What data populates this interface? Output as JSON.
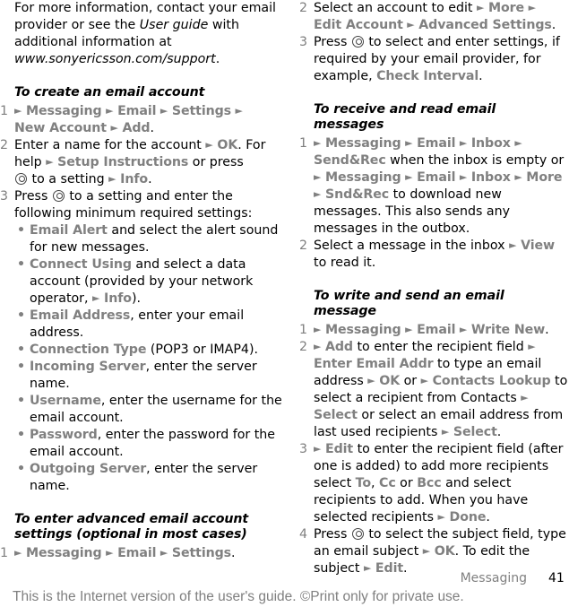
{
  "intro": {
    "t1": "For more information, contact your email provider or see the ",
    "guide": "User guide",
    "t2": " with additional information at ",
    "url": "www.sonyericsson.com/support",
    "t3": "."
  },
  "create": {
    "heading": "To create an email account",
    "s1": {
      "num": "1",
      "a": "Messaging",
      "b": "Email",
      "c": "Settings",
      "d": "New Account",
      "e": "Add",
      "end": "."
    },
    "s2": {
      "num": "2",
      "t1": "Enter a name for the account ",
      "ok": "OK",
      "t2": ". For help ",
      "setup": "Setup Instructions",
      "t3": " or press ",
      "t4": " to a setting ",
      "info": "Info",
      "end": "."
    },
    "s3": {
      "num": "3",
      "t1": "Press ",
      "t2": " to a setting and enter the following minimum required settings:"
    },
    "bullets": [
      {
        "label": "Email Alert",
        "text": " and select the alert sound for new messages."
      },
      {
        "label": "Connect Using",
        "text": " and select a data account (provided by your network operator, ",
        "info": "Info",
        "end": ")."
      },
      {
        "label": "Email Address",
        "text": ", enter your email address."
      },
      {
        "label": "Connection Type",
        "text": " (POP3 or IMAP4)."
      },
      {
        "label": "Incoming Server",
        "text": ", enter the server name."
      },
      {
        "label": "Username",
        "text": ", enter the username for the email account."
      },
      {
        "label": "Password",
        "text": ", enter the password for the email account."
      },
      {
        "label": "Outgoing Server",
        "text": ", enter the server name."
      }
    ]
  },
  "advanced": {
    "heading": "To enter advanced email account settings (optional in most cases)",
    "s1": {
      "num": "1",
      "a": "Messaging",
      "b": "Email",
      "c": "Settings",
      "end": "."
    },
    "s2": {
      "num": "2",
      "t1": "Select an account to edit ",
      "more": "More",
      "edit": "Edit Account",
      "adv": "Advanced Settings",
      "end": "."
    },
    "s3": {
      "num": "3",
      "t1": "Press ",
      "t2": " to select and enter settings, if required by your email provider, for example, ",
      "check": "Check Interval",
      "end": "."
    }
  },
  "receive": {
    "heading": "To receive and read email messages",
    "s1": {
      "num": "1",
      "a": "Messaging",
      "b": "Email",
      "c": "Inbox",
      "d": "Send&Rec",
      "t1": " when the inbox is empty or ",
      "e": "Messaging",
      "f": "Email",
      "g": "Inbox",
      "h": "More",
      "i": "Snd&Rec",
      "t2": " to download new messages. This also sends any messages in the outbox."
    },
    "s2": {
      "num": "2",
      "t1": "Select a message in the inbox ",
      "view": "View",
      "t2": " to read it."
    }
  },
  "send": {
    "heading": "To write and send an email message",
    "s1": {
      "num": "1",
      "a": "Messaging",
      "b": "Email",
      "c": "Write New",
      "end": "."
    },
    "s2": {
      "num": "2",
      "add": "Add",
      "t1": " to enter the recipient field ",
      "enter": "Enter Email Addr",
      "t2": " to type an email address ",
      "ok": "OK",
      "t3": " or ",
      "lookup": "Contacts Lookup",
      "t4": " to select a recipient from Contacts ",
      "select1": "Select",
      "t5": " or select an email address from last used recipients ",
      "select2": "Select",
      "end": "."
    },
    "s3": {
      "num": "3",
      "edit": "Edit",
      "t1": " to enter the recipient field (after one is added) to add more recipients select ",
      "to": "To",
      "c1": ", ",
      "cc": "Cc",
      "t2": " or ",
      "bcc": "Bcc",
      "t3": " and select recipients to add. When you have selected recipients ",
      "done": "Done",
      "end": "."
    },
    "s4": {
      "num": "4",
      "t1": "Press ",
      "t2": " to select the subject field, type an email subject ",
      "ok": "OK",
      "t3": ". To edit the subject ",
      "edit": "Edit",
      "end": "."
    }
  },
  "icons": {
    "arrow": "►",
    "nav_key": "navigation-key-icon"
  },
  "colors": {
    "ui_term": "#808080",
    "text": "#000000",
    "footer": "#7f7f7f"
  },
  "footer": {
    "section": "Messaging",
    "page": "41",
    "note": "This is the Internet version of the user's guide. ©Print only for private use."
  }
}
